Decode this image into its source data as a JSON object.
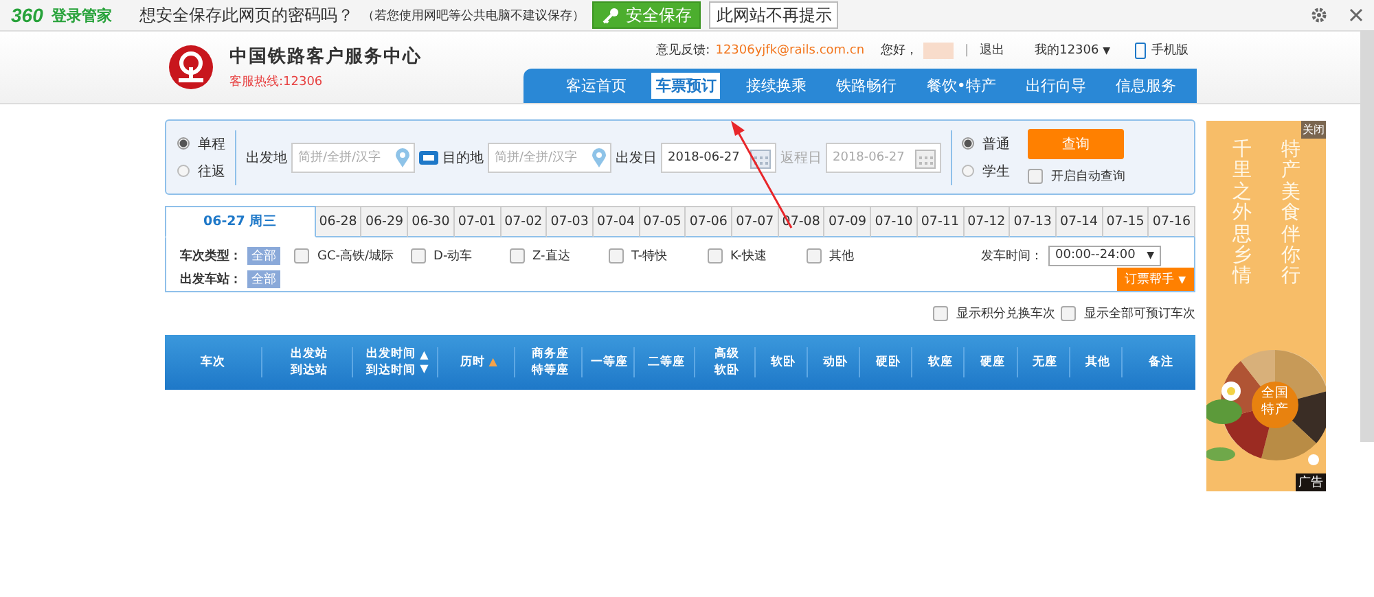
{
  "topbar": {
    "brand": "360",
    "brand_suffix": "登录管家",
    "prompt": "想安全保存此网页的密码吗？",
    "note": "（若您使用网吧等公共电脑不建议保存）",
    "save": "安全保存",
    "dismiss": "此网站不再提示"
  },
  "header": {
    "title": "中国铁路客户服务中心",
    "hotline": "客服热线:12306",
    "feedback_label": "意见反馈:",
    "feedback_email": "12306yjfk@rails.com.cn",
    "greeting": "您好，",
    "separator": "|",
    "logout": "退出",
    "account": "我的12306",
    "account_caret": "▼",
    "mobile": "手机版",
    "nav": [
      {
        "label": "客运首页",
        "selected": false
      },
      {
        "label": "车票预订",
        "selected": true
      },
      {
        "label": "接续换乘",
        "selected": false
      },
      {
        "label": "铁路畅行",
        "selected": false
      },
      {
        "label": "餐饮•特产",
        "selected": false
      },
      {
        "label": "出行向导",
        "selected": false
      },
      {
        "label": "信息服务",
        "selected": false
      }
    ]
  },
  "search": {
    "trip_types": [
      {
        "label": "单程",
        "selected": true
      },
      {
        "label": "往返",
        "selected": false
      }
    ],
    "from_label": "出发地",
    "from_placeholder": "简拼/全拼/汉字",
    "to_label": "目的地",
    "to_placeholder": "简拼/全拼/汉字",
    "depart_label": "出发日",
    "depart_date": "2018-06-27",
    "return_label": "返程日",
    "return_date": "2018-06-27",
    "return_disabled": true,
    "passenger_types": [
      {
        "label": "普通",
        "selected": true
      },
      {
        "label": "学生",
        "selected": false
      }
    ],
    "query": "查询",
    "auto_query": {
      "label": "开启自动查询",
      "checked": false
    }
  },
  "dates": [
    {
      "label": "06-27 周三",
      "selected": true
    },
    {
      "label": "06-28",
      "selected": false
    },
    {
      "label": "06-29",
      "selected": false
    },
    {
      "label": "06-30",
      "selected": false
    },
    {
      "label": "07-01",
      "selected": false
    },
    {
      "label": "07-02",
      "selected": false
    },
    {
      "label": "07-03",
      "selected": false
    },
    {
      "label": "07-04",
      "selected": false
    },
    {
      "label": "07-05",
      "selected": false
    },
    {
      "label": "07-06",
      "selected": false
    },
    {
      "label": "07-07",
      "selected": false
    },
    {
      "label": "07-08",
      "selected": false
    },
    {
      "label": "07-09",
      "selected": false
    },
    {
      "label": "07-10",
      "selected": false
    },
    {
      "label": "07-11",
      "selected": false
    },
    {
      "label": "07-12",
      "selected": false
    },
    {
      "label": "07-13",
      "selected": false
    },
    {
      "label": "07-14",
      "selected": false
    },
    {
      "label": "07-15",
      "selected": false
    },
    {
      "label": "07-16",
      "selected": false
    }
  ],
  "filters": {
    "train_type_label": "车次类型：",
    "train_type_all": "全部",
    "train_types": [
      {
        "label": "GC-高铁/城际",
        "checked": false
      },
      {
        "label": "D-动车",
        "checked": false
      },
      {
        "label": "Z-直达",
        "checked": false
      },
      {
        "label": "T-特快",
        "checked": false
      },
      {
        "label": "K-快速",
        "checked": false
      },
      {
        "label": "其他",
        "checked": false
      }
    ],
    "station_label": "出发车站：",
    "station_all": "全部",
    "time_label": "发车时间：",
    "time_value": "00:00--24:00",
    "time_caret": "▼",
    "helper": "订票帮手",
    "helper_caret": "▼"
  },
  "options": [
    {
      "label": "显示积分兑换车次",
      "checked": false
    },
    {
      "label": "显示全部可预订车次",
      "checked": false
    }
  ],
  "table": {
    "columns": [
      {
        "lines": [
          "车次"
        ]
      },
      {
        "lines": [
          "出发站",
          "到达站"
        ]
      },
      {
        "lines": [
          "出发时间",
          "到达时间"
        ],
        "arrows": [
          "▲",
          "▼"
        ],
        "active": false
      },
      {
        "lines": [
          "历时"
        ],
        "arrows": [
          "▲"
        ],
        "active": true
      },
      {
        "lines": [
          "商务座",
          "特等座"
        ]
      },
      {
        "lines": [
          "一等座"
        ]
      },
      {
        "lines": [
          "二等座"
        ]
      },
      {
        "lines": [
          "高级",
          "软卧"
        ]
      },
      {
        "lines": [
          "软卧"
        ]
      },
      {
        "lines": [
          "动卧"
        ]
      },
      {
        "lines": [
          "硬卧"
        ]
      },
      {
        "lines": [
          "软座"
        ]
      },
      {
        "lines": [
          "硬座"
        ]
      },
      {
        "lines": [
          "无座"
        ]
      },
      {
        "lines": [
          "其他"
        ]
      },
      {
        "lines": [
          "备注"
        ]
      }
    ]
  },
  "ad": {
    "close": "关闭",
    "columns": [
      "千里之外思乡情",
      "特产美食伴你行"
    ],
    "badge": [
      "全国",
      "特产"
    ],
    "label": "广告"
  }
}
